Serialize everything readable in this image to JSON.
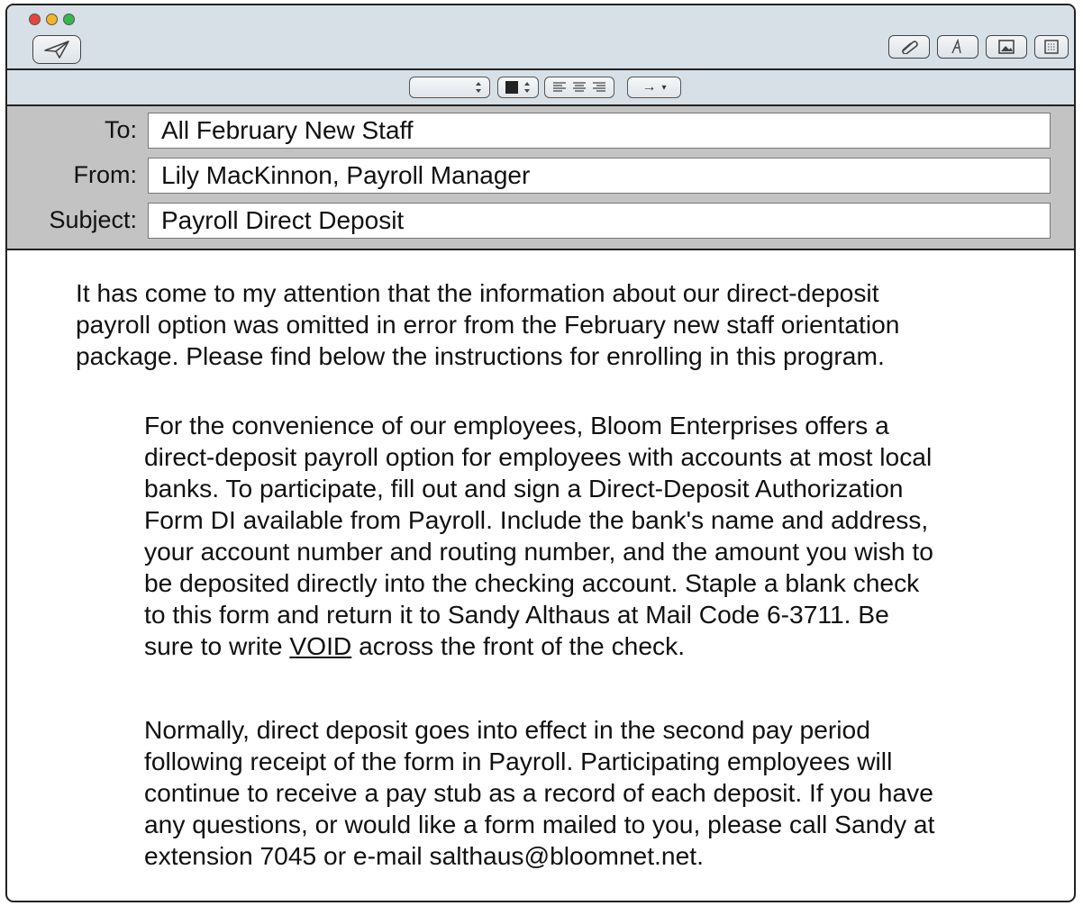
{
  "toolbar": {
    "buttons": [
      {
        "name": "send-button",
        "icon": "paper-plane-icon"
      },
      {
        "name": "attach-button",
        "icon": "paperclip-icon"
      },
      {
        "name": "fonts-button",
        "icon": "font-icon"
      },
      {
        "name": "photo-browser-button",
        "icon": "image-icon"
      },
      {
        "name": "stationery-button",
        "icon": "template-icon"
      }
    ]
  },
  "format_bar": {
    "arrows": "→",
    "arrow_caret": "▾"
  },
  "headers": {
    "to_label": "To:",
    "to_value": "All February New Staff",
    "from_label": "From:",
    "from_value": "Lily MacKinnon, Payroll Manager",
    "subject_label": "Subject:",
    "subject_value": "Payroll Direct Deposit"
  },
  "body": {
    "intro_lines": [
      "It has come to my attention that the information about our direct-deposit",
      "payroll option was omitted in error from the February new staff orientation",
      "package. Please find below the instructions for enrolling in this program."
    ],
    "para1_lines": [
      "For the convenience of our employees, Bloom Enterprises offers a",
      "direct-deposit payroll option for employees with accounts at most local",
      "banks. To participate, fill out and sign a Direct-Deposit Authorization",
      "Form DI available from Payroll. Include the bank's name and address,",
      "your account number and routing number, and the amount you wish to",
      "be deposited directly into the checking account. Staple a blank check",
      "to this form and return it to Sandy Althaus at Mail Code 6-3711. Be"
    ],
    "para1_last_prefix": "sure to write ",
    "para1_last_underlined": "VOID",
    "para1_last_suffix": " across the front of the check.",
    "para2_lines": [
      "Normally, direct deposit goes into effect in the second pay period",
      "following receipt of the form in Payroll. Participating employees will",
      "continue to receive a pay stub as a record of each deposit. If you have",
      "any questions, or would like a form mailed to you, please call Sandy at",
      "extension 7045 or e-mail salthaus@bloomnet.net."
    ]
  }
}
